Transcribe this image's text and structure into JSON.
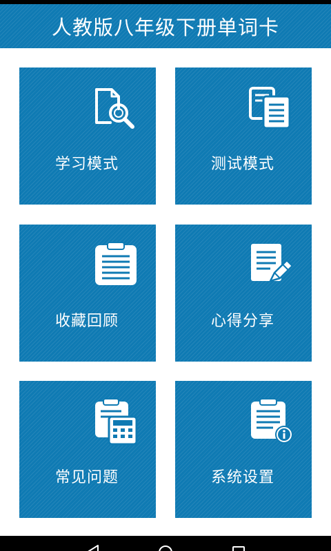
{
  "header": {
    "title": "人教版八年级下册单词卡"
  },
  "tiles": [
    {
      "label": "学习模式",
      "icon": "document-search-icon"
    },
    {
      "label": "测试模式",
      "icon": "copy-documents-icon"
    },
    {
      "label": "收藏回顾",
      "icon": "clipboard-notes-icon"
    },
    {
      "label": "心得分享",
      "icon": "edit-document-icon"
    },
    {
      "label": "常见问题",
      "icon": "clipboard-calculator-icon"
    },
    {
      "label": "系统设置",
      "icon": "clipboard-info-icon"
    }
  ],
  "navigation_bar": {
    "buttons": [
      "back-icon",
      "home-icon",
      "recent-apps-icon"
    ]
  },
  "colors": {
    "tile_blue": "#0f7ab3",
    "text": "#ffffff",
    "status_bar": "#000000"
  }
}
